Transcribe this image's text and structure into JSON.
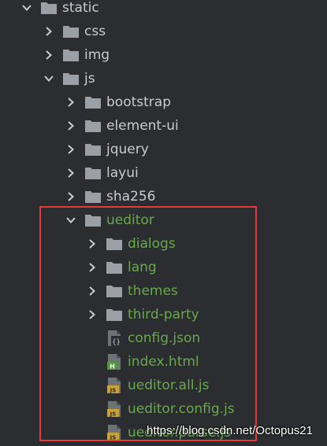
{
  "project_tree": {
    "static": {
      "label": "static"
    },
    "css": {
      "label": "css"
    },
    "img": {
      "label": "img"
    },
    "js": {
      "label": "js"
    },
    "bootstrap": {
      "label": "bootstrap"
    },
    "element_ui": {
      "label": "element-ui"
    },
    "jquery": {
      "label": "jquery"
    },
    "layui": {
      "label": "layui"
    },
    "sha256": {
      "label": "sha256"
    },
    "ueditor": {
      "label": "ueditor"
    },
    "dialogs": {
      "label": "dialogs"
    },
    "lang": {
      "label": "lang"
    },
    "themes": {
      "label": "themes"
    },
    "third_party": {
      "label": "third-party"
    },
    "config_json": {
      "label": "config.json"
    },
    "index_html": {
      "label": "index.html"
    },
    "ueditor_all_js": {
      "label": "ueditor.all.js"
    },
    "ueditor_config_js": {
      "label": "ueditor.config.js"
    },
    "ueditor_parse_js": {
      "label": "ueditor.parse.js"
    }
  },
  "watermark": {
    "text": "https://blog.csdn.net/Octopus21"
  },
  "colors": {
    "background": "#2b2d30",
    "folder": "#9aa0a6",
    "text": "#c9cbd0",
    "vcs_added": "#6aa84f",
    "highlight_border": "#e23b3b"
  },
  "icons": {
    "chevron_expanded": "chevron-down-icon",
    "chevron_collapsed": "chevron-right-icon",
    "folder": "folder-icon",
    "json_file": "json-file-icon",
    "html_file": "html-file-icon",
    "js_file": "js-file-icon"
  }
}
